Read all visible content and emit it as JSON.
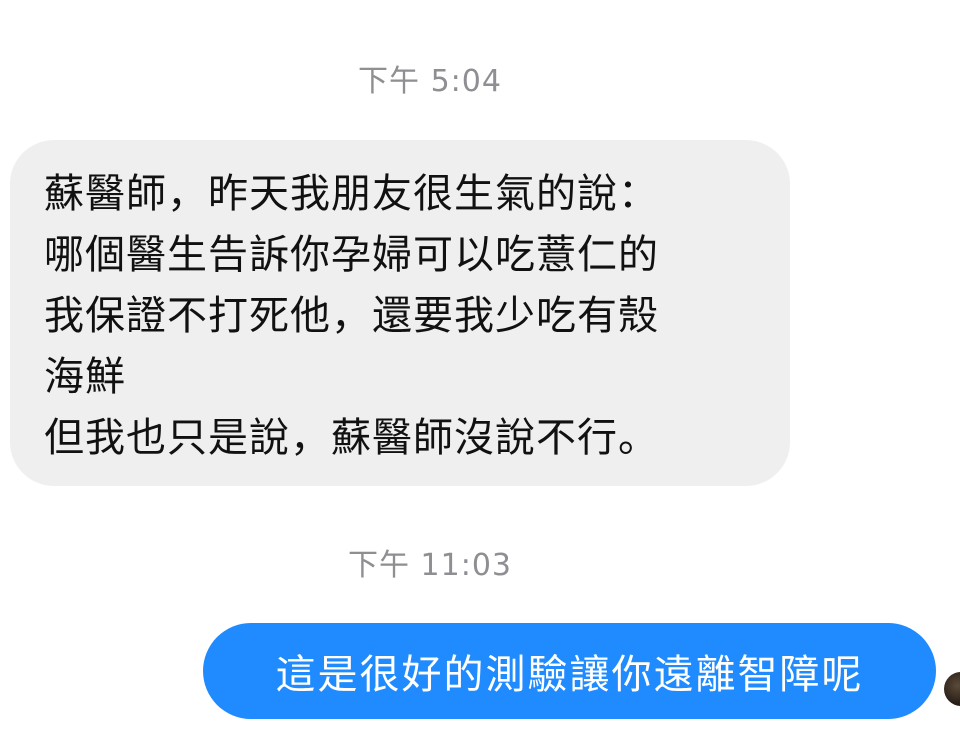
{
  "messages": [
    {
      "timestamp": "下午 5:04",
      "direction": "incoming",
      "lines": [
        "蘇醫師，昨天我朋友很生氣的說：",
        "哪個醫生告訴你孕婦可以吃薏仁的",
        "我保證不打死他，還要我少吃有殼",
        "海鮮",
        "但我也只是說，蘇醫師沒說不行。"
      ]
    },
    {
      "timestamp": "下午 11:03",
      "direction": "outgoing",
      "text": "這是很好的測驗讓你遠離智障呢"
    }
  ],
  "colors": {
    "incoming_bubble": "#efeff0",
    "outgoing_bubble": "#1f8bff",
    "timestamp": "#8e8e93"
  },
  "icons": {
    "avatar": "user-avatar"
  }
}
